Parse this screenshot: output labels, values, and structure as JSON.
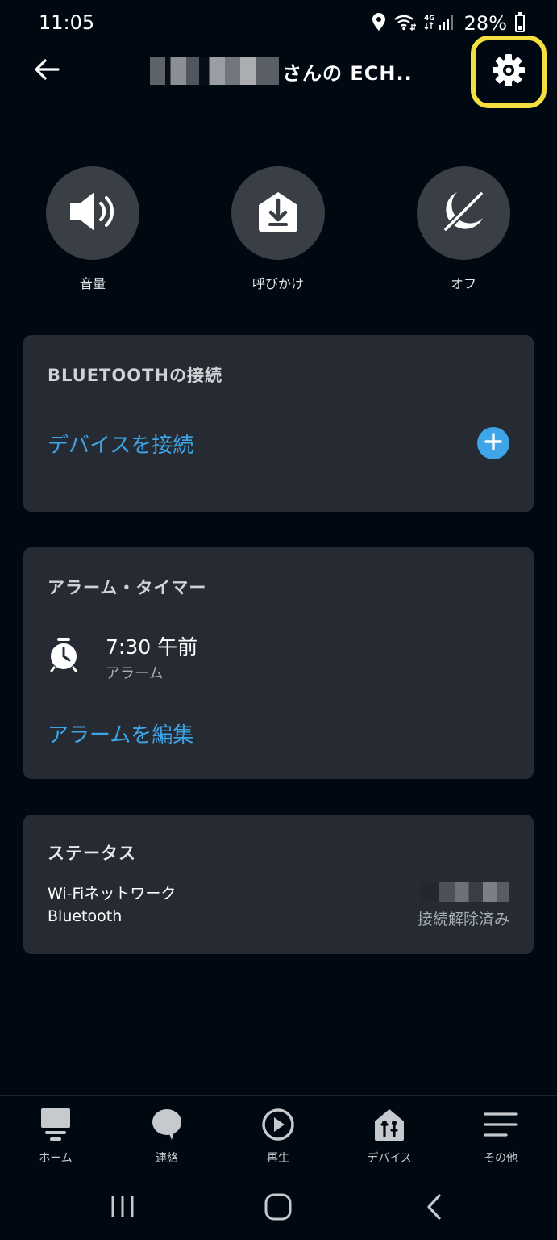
{
  "status_bar": {
    "time": "11:05",
    "battery": "28%"
  },
  "header": {
    "title": "さんの ECH.."
  },
  "quick_actions": [
    {
      "label": "音量",
      "icon": "speaker-icon"
    },
    {
      "label": "呼びかけ",
      "icon": "drop-in-icon"
    },
    {
      "label": "オフ",
      "icon": "do-not-disturb-icon"
    }
  ],
  "bluetooth": {
    "title": "BLUETOOTHの接続",
    "connect_label": "デバイスを接続"
  },
  "alarms": {
    "title": "アラーム・タイマー",
    "alarm_time": "7:30 午前",
    "alarm_type": "アラーム",
    "edit_label": "アラームを編集"
  },
  "status": {
    "title": "ステータス",
    "rows": [
      {
        "label": "Wi-Fiネットワーク",
        "value": ""
      },
      {
        "label": "Bluetooth",
        "value": "接続解除済み"
      }
    ]
  },
  "bottom_nav": [
    {
      "label": "ホーム",
      "icon": "home-icon"
    },
    {
      "label": "連絡",
      "icon": "chat-bubble-icon"
    },
    {
      "label": "再生",
      "icon": "play-icon"
    },
    {
      "label": "デバイス",
      "icon": "devices-icon"
    },
    {
      "label": "その他",
      "icon": "menu-icon"
    }
  ],
  "colors": {
    "background": "#000811",
    "card": "#262b33",
    "accent": "#3ea6e8",
    "highlight": "#f5df3f"
  }
}
